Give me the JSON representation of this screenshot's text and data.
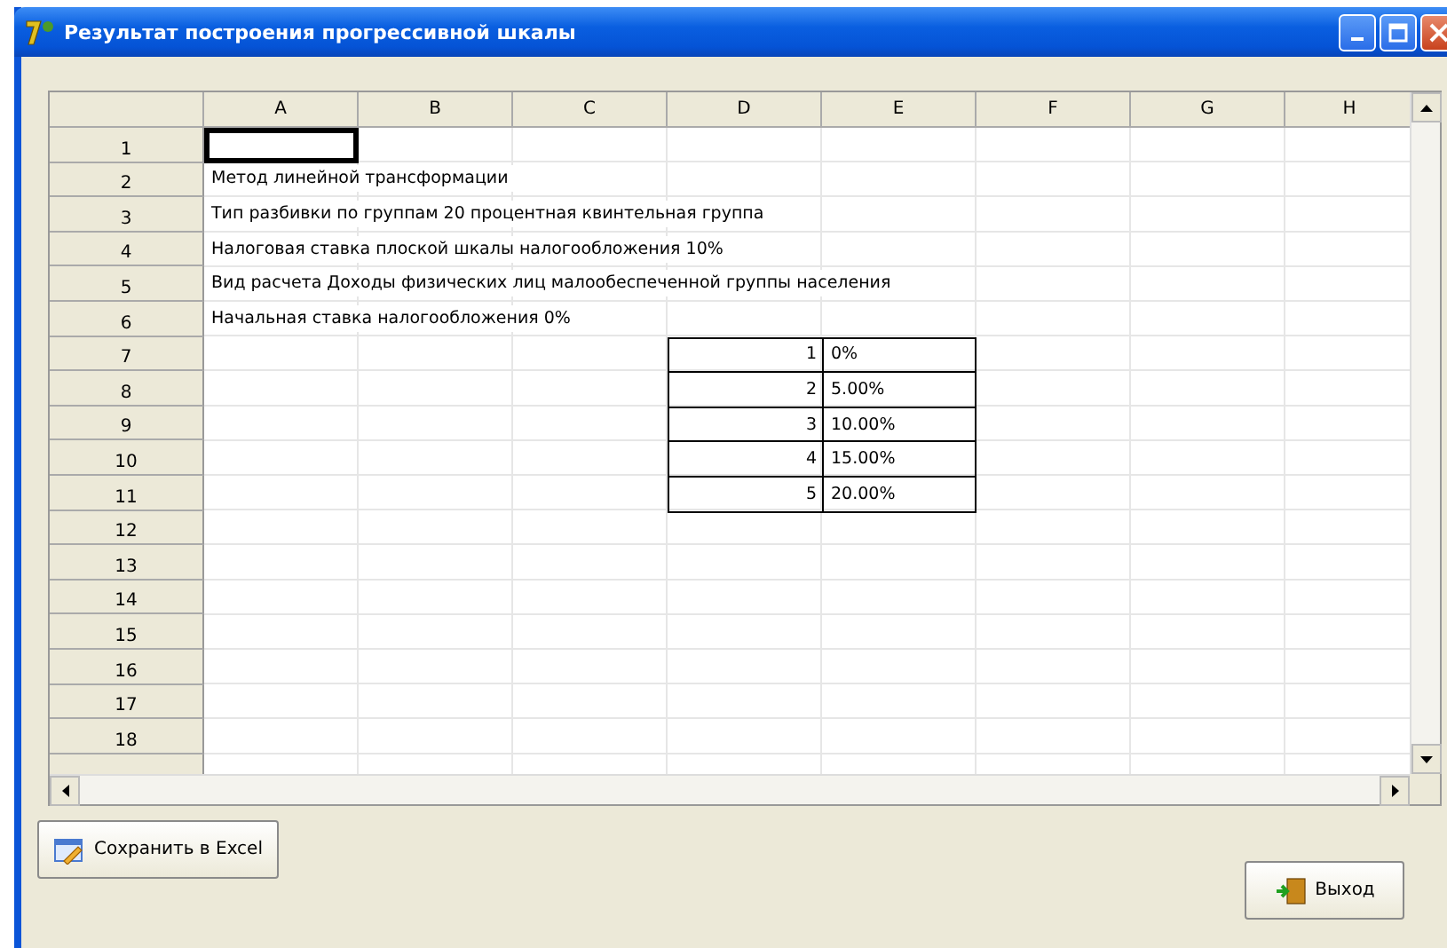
{
  "window": {
    "title": "Результат  построения прогрессивной шкалы"
  },
  "grid": {
    "columns": [
      "A",
      "B",
      "C",
      "D",
      "E",
      "F",
      "G",
      "H"
    ],
    "rows": [
      {
        "header": "1",
        "kind": "blank",
        "focused": true
      },
      {
        "header": "2",
        "kind": "note",
        "focused": false,
        "text": "Метод линейной трансформации"
      },
      {
        "header": "3",
        "kind": "note",
        "focused": false,
        "text": "Тип разбивки по группам 20 процентная квинтельная группа"
      },
      {
        "header": "4",
        "kind": "note",
        "focused": false,
        "text": "Налоговая ставка плоской шкалы налогообложения 10%"
      },
      {
        "header": "5",
        "kind": "note",
        "focused": false,
        "text": "Вид расчета Доходы физических лиц малообеспеченной группы населения"
      },
      {
        "header": "6",
        "kind": "note",
        "focused": false,
        "text": "Начальная ставка налогообложения 0%"
      },
      {
        "header": "7",
        "kind": "scale",
        "focused": false,
        "number": "1",
        "value": "0%"
      },
      {
        "header": "8",
        "kind": "scale",
        "focused": false,
        "number": "2",
        "value": "5.00%"
      },
      {
        "header": "9",
        "kind": "scale",
        "focused": false,
        "number": "3",
        "value": "10.00%"
      },
      {
        "header": "10",
        "kind": "scale",
        "focused": false,
        "number": "4",
        "value": "15.00%"
      },
      {
        "header": "11",
        "kind": "scale",
        "focused": false,
        "number": "5",
        "value": "20.00%"
      },
      {
        "header": "12",
        "kind": "blank",
        "focused": false
      },
      {
        "header": "13",
        "kind": "blank",
        "focused": false
      },
      {
        "header": "14",
        "kind": "blank",
        "focused": false
      },
      {
        "header": "15",
        "kind": "blank",
        "focused": false
      },
      {
        "header": "16",
        "kind": "blank",
        "focused": false
      },
      {
        "header": "17",
        "kind": "blank",
        "focused": false
      },
      {
        "header": "18",
        "kind": "blank",
        "focused": false
      }
    ]
  },
  "buttons": {
    "save": "Сохранить в Excel",
    "exit": "Выход"
  }
}
